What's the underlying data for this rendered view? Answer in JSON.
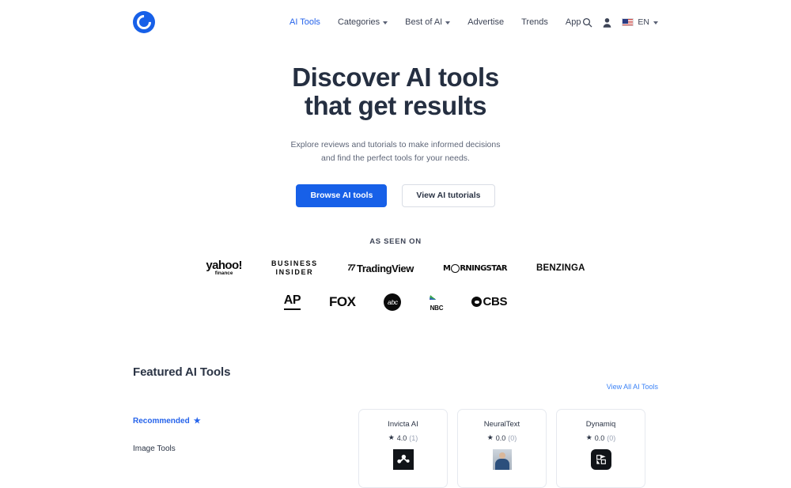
{
  "header": {
    "logo_icon": "circle-c-logo",
    "nav": [
      {
        "label": "AI Tools",
        "active": true,
        "caret": false
      },
      {
        "label": "Categories",
        "active": false,
        "caret": true
      },
      {
        "label": "Best of AI",
        "active": false,
        "caret": true
      },
      {
        "label": "Advertise",
        "active": false,
        "caret": false
      },
      {
        "label": "Trends",
        "active": false,
        "caret": false
      },
      {
        "label": "App",
        "active": false,
        "caret": false
      }
    ],
    "search_icon": "search-icon",
    "account_icon": "user-icon",
    "language": "EN",
    "flag": "us-flag"
  },
  "hero": {
    "title_line1": "Discover AI tools",
    "title_line2": "that get results",
    "subtitle": "Explore reviews and tutorials to make informed decisions and find the perfect tools for your needs.",
    "primary_button": "Browse AI tools",
    "secondary_button": "View AI tutorials"
  },
  "as_seen_on": {
    "title": "AS SEEN ON",
    "row1": [
      {
        "name": "yahoo!",
        "sub": "finance"
      },
      {
        "name": "BUSINESS",
        "sub": "INSIDER"
      },
      {
        "name": "TradingView",
        "sub": ""
      },
      {
        "name": "MORNINGSTAR",
        "sub": ""
      },
      {
        "name": "BENZINGA",
        "sub": ""
      }
    ],
    "row2": [
      {
        "name": "AP"
      },
      {
        "name": "FOX"
      },
      {
        "name": "abc"
      },
      {
        "name": "NBC"
      },
      {
        "name": "CBS"
      }
    ]
  },
  "featured": {
    "heading": "Featured AI Tools",
    "view_all": "View All AI Tools",
    "sidebar": [
      {
        "label": "Recommended",
        "star": true,
        "active": true
      },
      {
        "label": "Image Tools",
        "star": false,
        "active": false
      }
    ],
    "cards": [
      {
        "name": "Invicta AI",
        "rating": "4.0",
        "count": "(1)",
        "logo": "invicta-nodes-logo",
        "glyph": "∴"
      },
      {
        "name": "NeuralText",
        "rating": "0.0",
        "count": "(0)",
        "logo": "neuraltext-photo-logo",
        "glyph": ""
      },
      {
        "name": "Dynamiq",
        "rating": "0.0",
        "count": "(0)",
        "logo": "dynamiq-pinwheel-logo",
        "glyph": "❇"
      }
    ],
    "star_glyph": "★"
  },
  "colors": {
    "accent_blue": "#1760e8",
    "link_blue": "#3b82f6",
    "text_dark": "#2b3445"
  }
}
